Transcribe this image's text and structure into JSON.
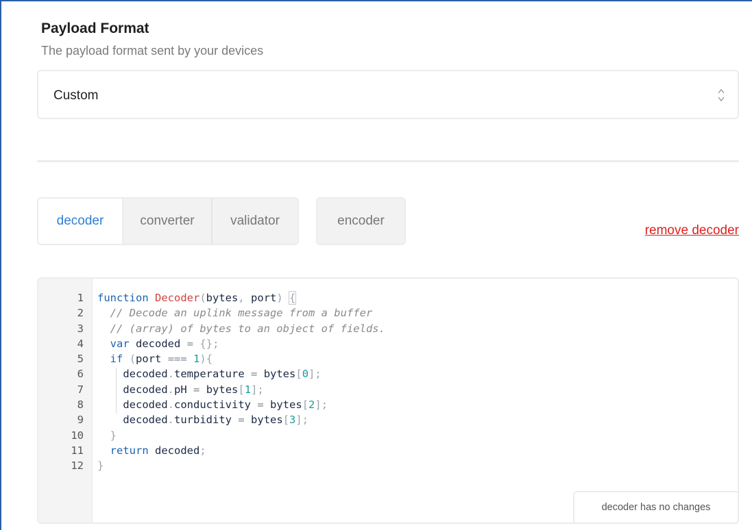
{
  "payload_format": {
    "title": "Payload Format",
    "description": "The payload format sent by your devices",
    "selected": "Custom"
  },
  "tabs": {
    "decoder": "decoder",
    "converter": "converter",
    "validator": "validator",
    "encoder": "encoder"
  },
  "remove_label": "remove decoder",
  "editor": {
    "line_numbers": [
      "1",
      "2",
      "3",
      "4",
      "5",
      "6",
      "7",
      "8",
      "9",
      "10",
      "11",
      "12"
    ],
    "code": [
      "function Decoder(bytes, port) {",
      "  // Decode an uplink message from a buffer",
      "  // (array) of bytes to an object of fields.",
      "  var decoded = {};",
      "  if (port === 1){",
      "    decoded.temperature = bytes[0];",
      "    decoded.pH = bytes[1];",
      "    decoded.conductivity = bytes[2];",
      "    decoded.turbidity = bytes[3];",
      "  }",
      "  return decoded;",
      "}"
    ],
    "status": "decoder has no changes"
  },
  "colors": {
    "accent": "#2f7fd6",
    "danger": "#e02020",
    "frame": "#2a5fa8"
  },
  "icons": {
    "select_arrows": "sort-arrows-icon"
  }
}
